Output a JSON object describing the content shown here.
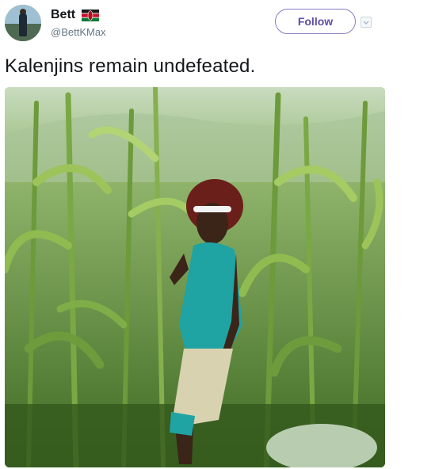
{
  "tweet": {
    "author_name": "Bett",
    "author_handle": "@BettKMax",
    "follow_label": "Follow",
    "text": "Kalenjins remain undefeated."
  },
  "icons": {
    "avatar": "user-avatar",
    "flag": "kenya-flag-emoji",
    "menu": "chevron-down-icon"
  },
  "colors": {
    "follow_border": "#8b7bc4",
    "follow_text": "#5b4ea8",
    "handle_text": "#657786"
  }
}
